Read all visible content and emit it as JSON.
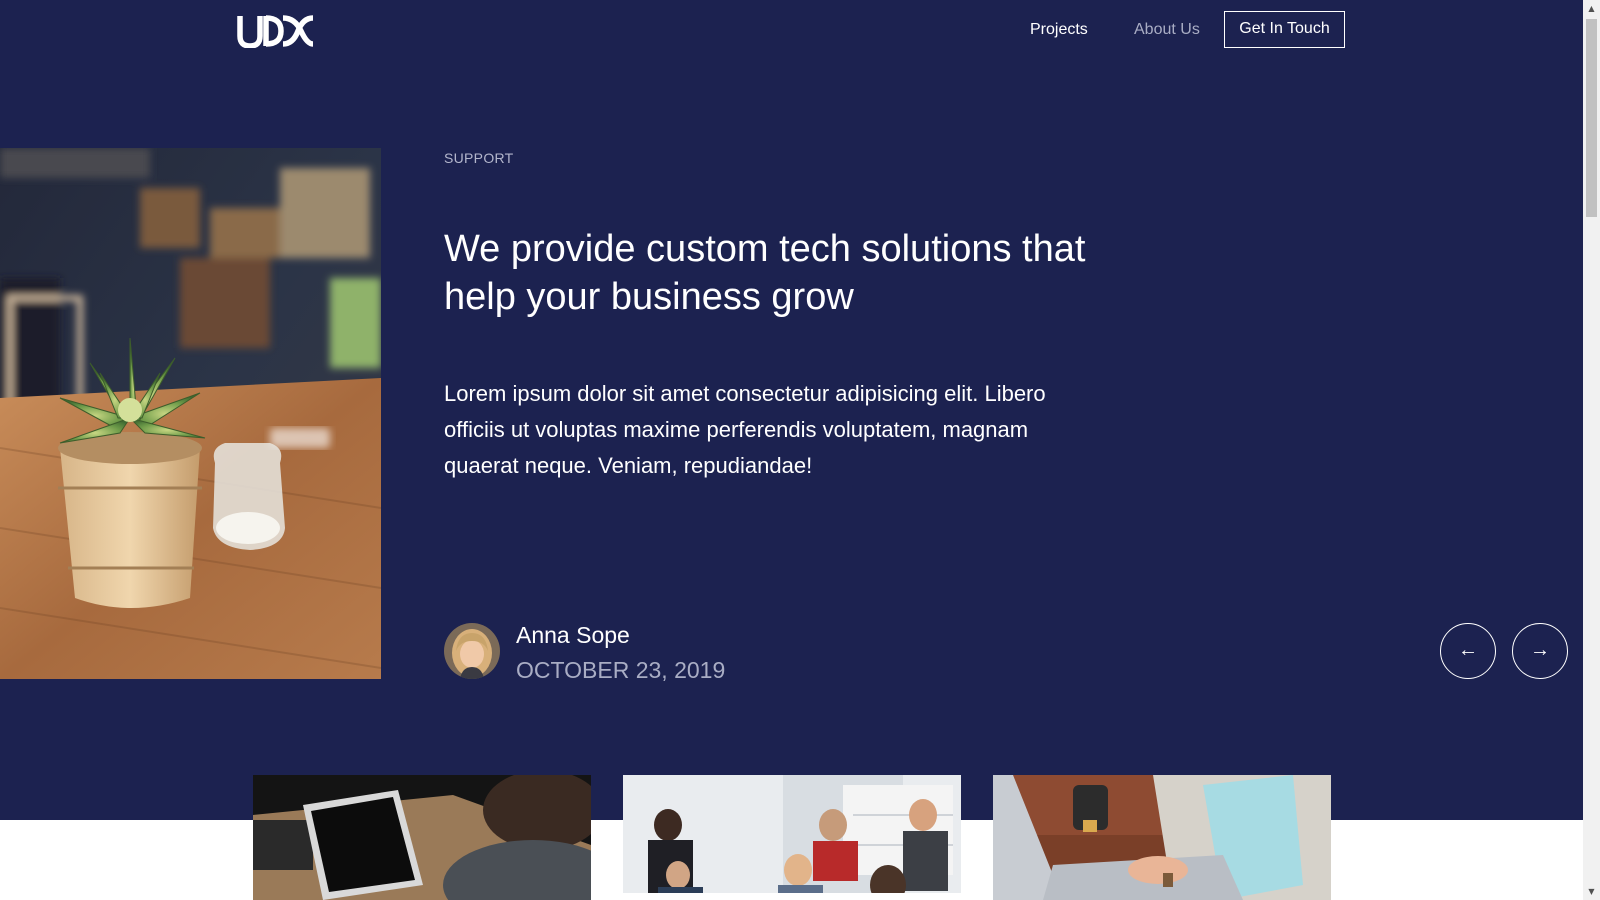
{
  "brand": {
    "logo_text": "UDX"
  },
  "nav": {
    "projects": "Projects",
    "about": "About Us",
    "cta": "Get In Touch"
  },
  "hero": {
    "eyebrow": "SUPPORT",
    "headline": "We provide custom tech solutions that help your business grow",
    "body": "Lorem ipsum dolor sit amet consectetur adipisicing elit. Libero officiis ut voluptas maxime perferendis voluptatem, magnam quaerat neque. Veniam, repudiandae!",
    "author": {
      "name": "Anna Sope",
      "date": "OCTOBER 23, 2019"
    },
    "prev_icon": "←",
    "next_icon": "→"
  },
  "colors": {
    "hero_bg": "#1c2250",
    "accent_text": "#a9adc4",
    "white": "#ffffff"
  },
  "icons": [
    "arrow-left-icon",
    "arrow-right-icon",
    "scroll-up-icon",
    "scroll-down-icon"
  ],
  "scrollbar": {
    "up": "▲",
    "down": "▼"
  }
}
